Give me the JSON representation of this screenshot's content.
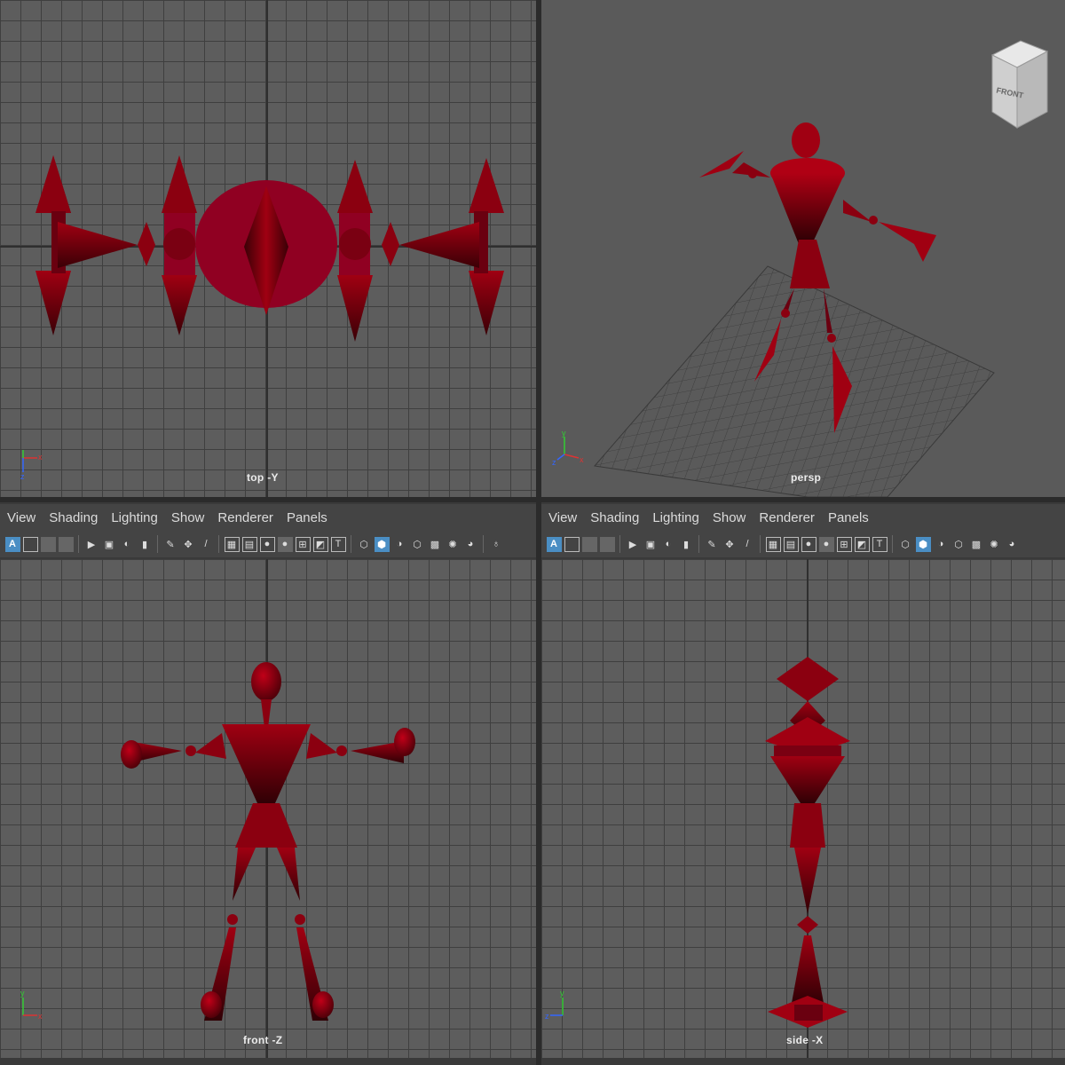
{
  "viewports": {
    "top": {
      "label": "top -Y"
    },
    "persp": {
      "label": "persp"
    },
    "front": {
      "label": "front -Z"
    },
    "side": {
      "label": "side -X"
    }
  },
  "panel_menu": [
    "View",
    "Shading",
    "Lighting",
    "Show",
    "Renderer",
    "Panels"
  ],
  "toolbar_icons": [
    "select-camera-icon",
    "camera-attributes-icon",
    "bookmark-icon",
    "image-plane-icon",
    "grid-icon",
    "film-gate-icon",
    "resolution-gate-icon",
    "gate-mask-icon",
    "field-chart-icon",
    "safe-action-icon",
    "safe-title-icon",
    "wireframe-icon",
    "smooth-shade-icon",
    "default-material-icon",
    "xray-icon",
    "textures-icon",
    "lights-icon",
    "shadows-icon",
    "isolate-icon"
  ],
  "view_cube": {
    "face": "FRONT"
  },
  "axes": {
    "x": "x",
    "y": "y",
    "z": "z"
  },
  "colors": {
    "rig": "#8b0010",
    "rig_dark": "#3a0006",
    "viewport_bg": "#5d5d5d",
    "grid": "#3f3f3f",
    "highlight": "#4a8ec4"
  }
}
